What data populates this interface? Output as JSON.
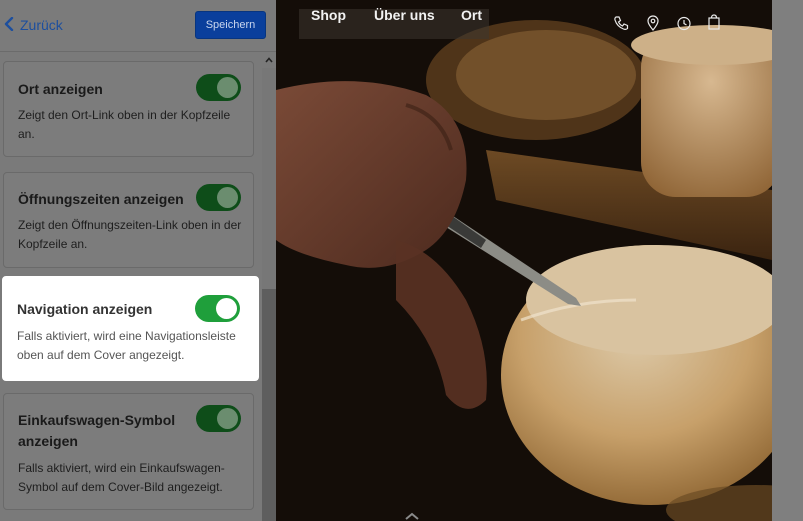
{
  "header": {
    "back_label": "Zurück",
    "save_label": "Speichern"
  },
  "settings": [
    {
      "title": "Ort anzeigen",
      "description": "Zeigt den Ort-Link oben in der Kopfzeile an.",
      "enabled": true
    },
    {
      "title": "Öffnungszeiten anzeigen",
      "description": "Zeigt den Öffnungszeiten-Link oben in der Kopfzeile an.",
      "enabled": true
    },
    {
      "title": "Navigation anzeigen",
      "description": "Falls aktiviert, wird eine Navigationsleiste oben auf dem Cover angezeigt.",
      "enabled": true
    },
    {
      "title": "Einkaufswagen-Symbol anzeigen",
      "description": "Falls aktiviert, wird ein Einkaufswagen-Symbol auf dem Cover-Bild angezeigt.",
      "enabled": true
    }
  ],
  "preview": {
    "nav_items": [
      "Shop",
      "Über uns",
      "Ort"
    ],
    "icons": [
      "phone-icon",
      "location-pin-icon",
      "clock-icon",
      "shopping-bag-icon"
    ]
  },
  "colors": {
    "accent": "#0a3f9c",
    "toggle_on": "#1f9f3b",
    "overlay_gray": "#7f7f7f"
  }
}
